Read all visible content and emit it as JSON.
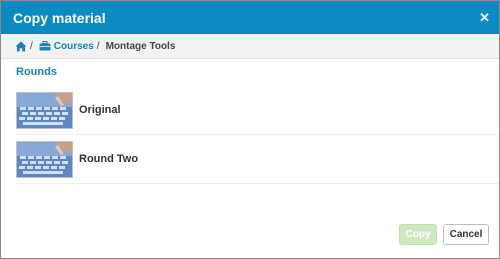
{
  "dialog": {
    "title": "Copy material",
    "close_icon": "close-icon",
    "close_glyph": "✕"
  },
  "breadcrumb": {
    "home_icon": "home-icon",
    "separator": "/",
    "courses_icon": "briefcase-icon",
    "courses_label": "Courses",
    "current": "Montage Tools"
  },
  "section": {
    "title": "Rounds"
  },
  "rounds": [
    {
      "label": "Original",
      "thumb_icon": "keyboard-thumbnail"
    },
    {
      "label": "Round Two",
      "thumb_icon": "keyboard-thumbnail"
    }
  ],
  "footer": {
    "copy_label": "Copy",
    "cancel_label": "Cancel"
  },
  "colors": {
    "header": "#0a8cc3",
    "link": "#1a82b8",
    "copy_disabled": "#cfe9c3"
  }
}
